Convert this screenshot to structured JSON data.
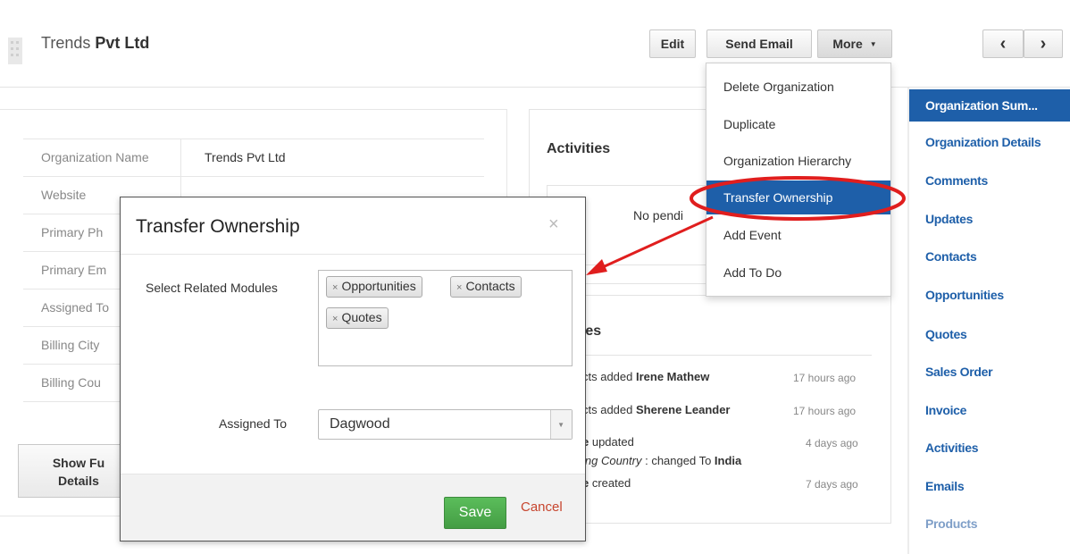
{
  "header": {
    "title_regular": "Trends",
    "title_bold": "Pvt Ltd",
    "buttons": {
      "edit": "Edit",
      "send_email": "Send Email",
      "more": "More"
    },
    "nav": {
      "prev": "‹",
      "next": "›"
    }
  },
  "summary": {
    "fields": [
      {
        "label": "Organization Name",
        "value": "Trends Pvt Ltd"
      },
      {
        "label": "Website",
        "value": ""
      },
      {
        "label": "Primary Ph",
        "value": ""
      },
      {
        "label": "Primary Em",
        "value": ""
      },
      {
        "label": "Assigned To",
        "value": ""
      },
      {
        "label": "Billing City",
        "value": ""
      },
      {
        "label": "Billing Cou",
        "value": ""
      }
    ],
    "show_full_line1": "Show Fu",
    "show_full_line2": "Details"
  },
  "activities": {
    "title": "Activities",
    "empty_text": "No pendi"
  },
  "updates": {
    "title": "tes",
    "items": [
      {
        "prefix": "cts added ",
        "bold": "Irene Mathew",
        "time": "17 hours ago"
      },
      {
        "prefix": "cts added ",
        "bold": "Sherene Leander",
        "time": "17 hours ago"
      },
      {
        "prefix": "e",
        "text": " updated",
        "time": "4 days ago",
        "detail_italic": "ing Country",
        "detail_text": " :  changed To ",
        "detail_bold": "India"
      },
      {
        "prefix": "e",
        "text": " created",
        "time": "7 days ago"
      }
    ]
  },
  "more_menu": {
    "items": [
      "Delete Organization",
      "Duplicate",
      "Organization Hierarchy",
      "Transfer Ownership",
      "Add Event",
      "Add To Do"
    ],
    "active": "Transfer Ownership"
  },
  "sidebar": {
    "items": [
      "Organization Sum...",
      "Organization Details",
      "Comments",
      "Updates",
      "Contacts",
      "Opportunities",
      "Quotes",
      "Sales Order",
      "Invoice",
      "Activities",
      "Emails",
      "Products"
    ],
    "active_index": 0
  },
  "modal": {
    "title": "Transfer Ownership",
    "close": "×",
    "modules_label": "Select Related Modules",
    "modules": [
      "Opportunities",
      "Contacts",
      "Quotes"
    ],
    "tag_remove": "×",
    "assigned_label": "Assigned To",
    "assigned_value": "Dagwood",
    "save": "Save",
    "cancel": "Cancel"
  },
  "colors": {
    "accent": "#1e5fa9",
    "save": "#4cae4c",
    "cancel": "#c7452e",
    "annotation": "#e01e1e"
  }
}
